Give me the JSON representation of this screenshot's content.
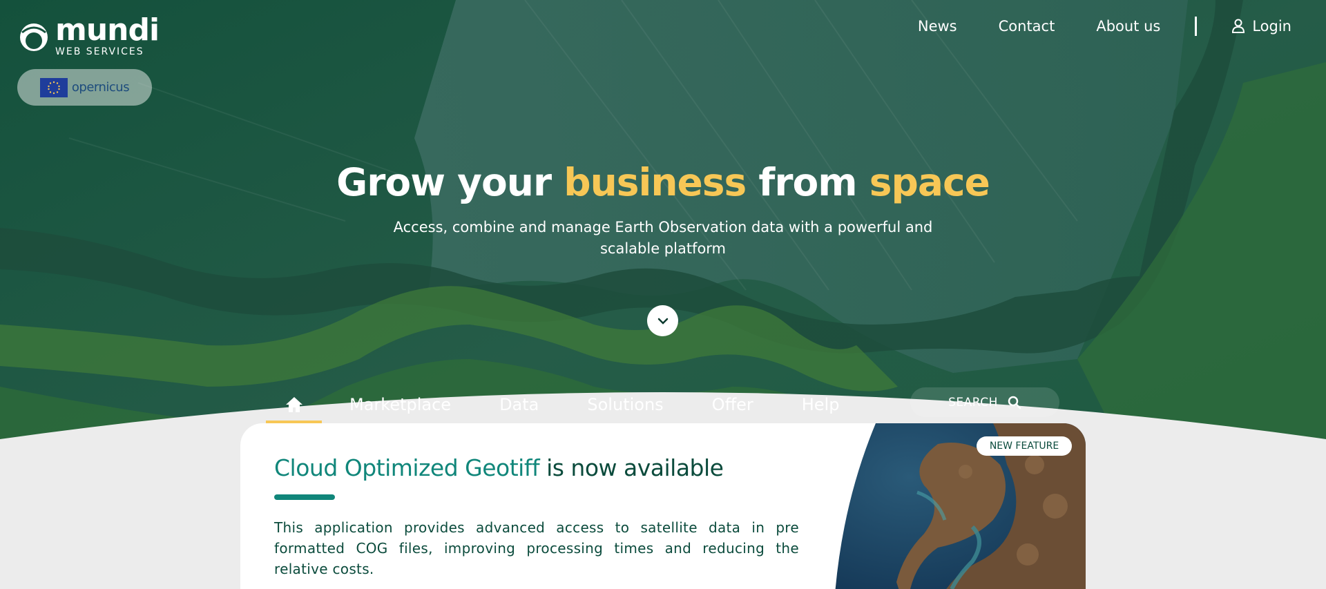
{
  "header": {
    "brand": "mundi",
    "brand_sub": "WEB SERVICES",
    "partner_logo_text": "opernicus",
    "nav": [
      "News",
      "Contact",
      "About us"
    ],
    "login_label": "Login"
  },
  "hero": {
    "headline_part1": "Grow your ",
    "headline_hl1": "business",
    "headline_part2": " from ",
    "headline_hl2": "space",
    "tagline": "Access, combine and manage Earth Observation data with a powerful and scalable platform"
  },
  "main_nav": {
    "items": [
      "Marketplace",
      "Data",
      "Solutions",
      "Offer",
      "Help"
    ],
    "search_label": "SEARCH"
  },
  "feature": {
    "title_accent": "Cloud Optimized Geotiff",
    "title_rest": " is now available",
    "description": "This application provides advanced access to satellite data in pre formatted COG files, improving processing times and reducing the relative costs.",
    "badge": "NEW FEATURE"
  },
  "colors": {
    "accent_yellow": "#f7c756",
    "teal": "#10867a",
    "dark_green": "#0b4b3c"
  }
}
